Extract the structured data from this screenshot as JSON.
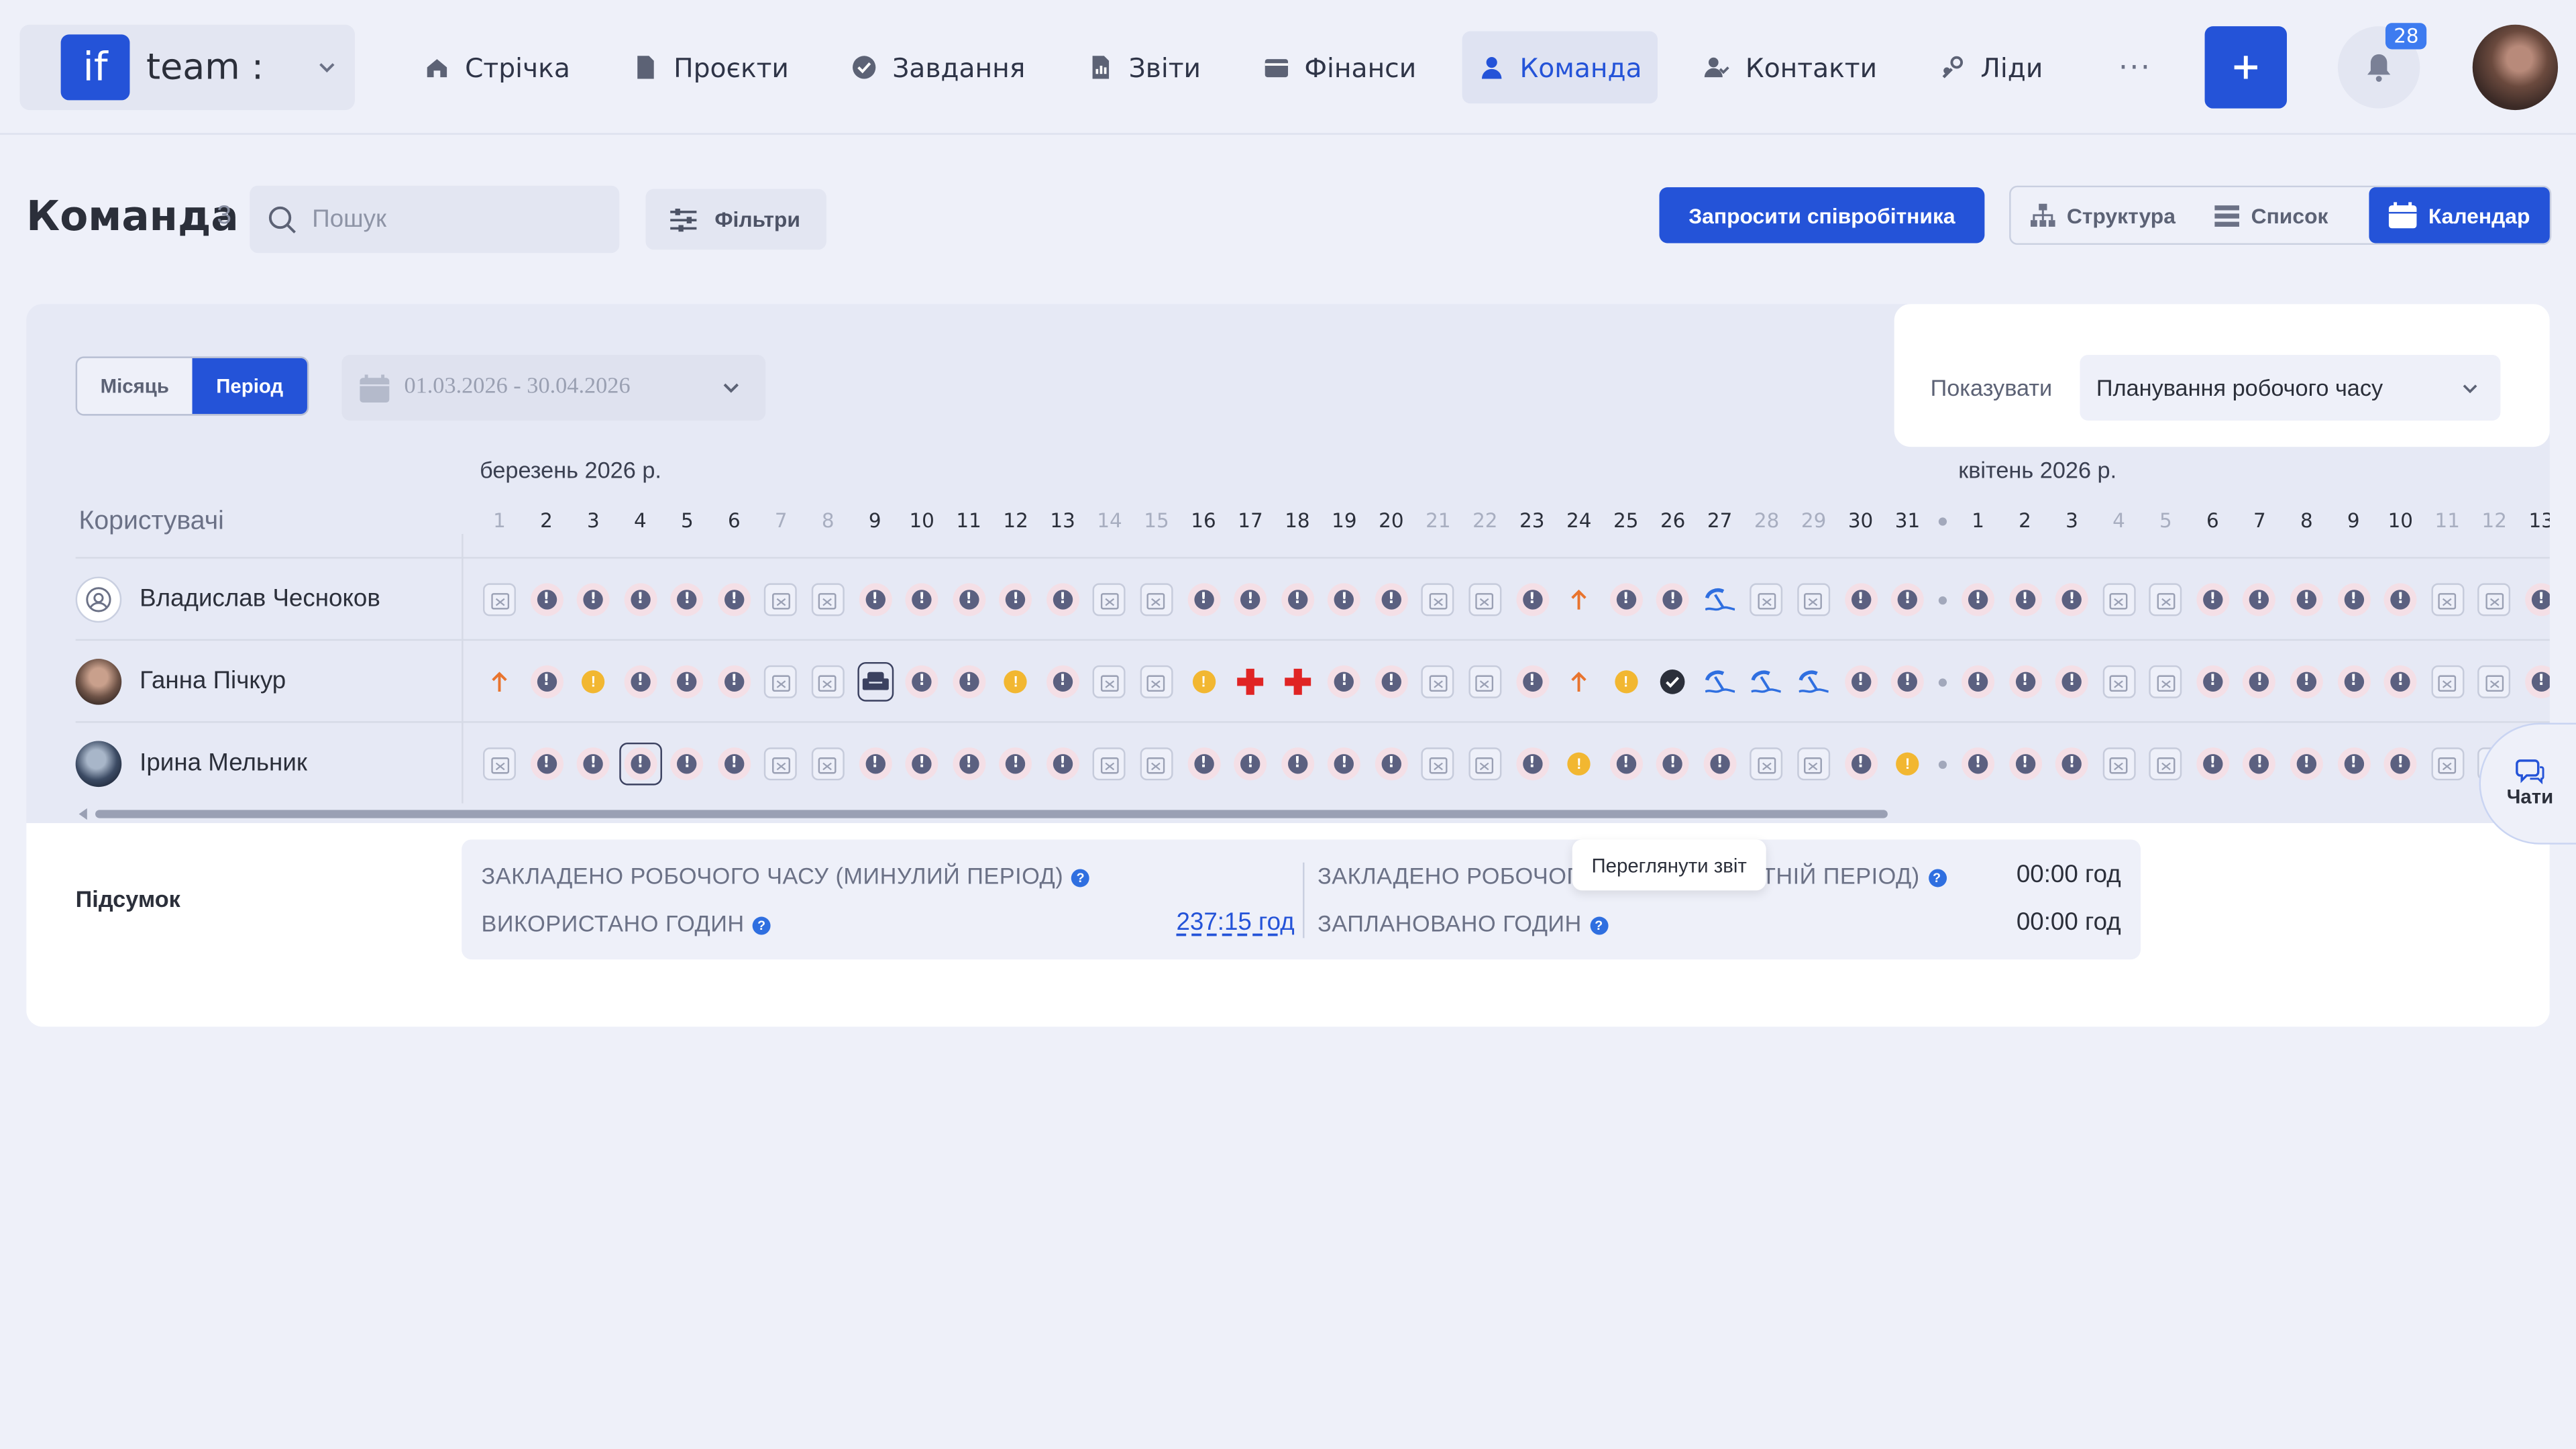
{
  "app": {
    "workspace": "team :",
    "logo": "if",
    "notifications": "28"
  },
  "nav": [
    {
      "label": "Стрічка",
      "icon": "home-icon"
    },
    {
      "label": "Проєкти",
      "icon": "file-icon"
    },
    {
      "label": "Завдання",
      "icon": "check-circle-icon"
    },
    {
      "label": "Звіти",
      "icon": "chart-icon"
    },
    {
      "label": "Фінанси",
      "icon": "wallet-icon"
    },
    {
      "label": "Команда",
      "icon": "user-icon",
      "active": true
    },
    {
      "label": "Контакти",
      "icon": "contacts-icon"
    },
    {
      "label": "Ліди",
      "icon": "leads-icon"
    }
  ],
  "nav_more": "···",
  "page": {
    "title": "Команда",
    "count": "3",
    "search_placeholder": "Пошук",
    "filters": "Фільтри",
    "invite": "Запросити співробітника",
    "views": [
      "Структура",
      "Список",
      "Календар"
    ],
    "active_view": "Календар"
  },
  "calendar": {
    "mode_month": "Місяць",
    "mode_period": "Період",
    "active_mode": "Період",
    "date_range": "01.03.2026 - 30.04.2026",
    "show_label": "Показувати",
    "show_value": "Планування робочого часу",
    "users_label": "Користувачі",
    "month1": "березень 2026 р.",
    "month2": "квітень 2026 р.",
    "march_days": [
      "1",
      "2",
      "3",
      "4",
      "5",
      "6",
      "7",
      "8",
      "9",
      "10",
      "11",
      "12",
      "13",
      "14",
      "15",
      "16",
      "17",
      "18",
      "19",
      "20",
      "21",
      "22",
      "23",
      "24",
      "25",
      "26",
      "27",
      "28",
      "29",
      "30",
      "31"
    ],
    "april_days": [
      "1",
      "2",
      "3",
      "4",
      "5",
      "6",
      "7",
      "8",
      "9",
      "10",
      "11",
      "12",
      "13"
    ],
    "weekend_march": [
      "1",
      "7",
      "8",
      "14",
      "15",
      "21",
      "22",
      "28",
      "29"
    ],
    "weekend_april": [
      "4",
      "5",
      "11",
      "12"
    ],
    "legend": {
      "E": "unfilled",
      "W": "weekend",
      "Y": "pending",
      "U": "arrow-up-icon",
      "S": "sick-icon",
      "V": "vacation-icon",
      "K": "approved-icon",
      "C": "couch-icon",
      "D": "month-divider"
    },
    "users": [
      {
        "name": "Владислав Чесноков",
        "row": "WEEEEEWWEEEEEWWEEEEEWWEUEEVWWEE|EEEWWEEEEEWWE"
      },
      {
        "name": "Ганна Пічкур",
        "row": "UEYEEEWWCEEYEWWYSSEEWWEUYKVVVEE|EEEWWEEEEEWWE"
      },
      {
        "name": "Ірина Мельник",
        "row": "WEEEEEWWEEEEEWWEEEEEWWEYEEEWWEY|EEEWWEEEEEWWE"
      }
    ]
  },
  "summary": {
    "label": "Підсумок",
    "past_planned": "ЗАКЛАДЕНО РОБОЧОГО ЧАСУ (МИНУЛИЙ ПЕРІОД)",
    "used": "ВИКОРИСТАНО ГОДИН",
    "used_value": "237:15 год",
    "tooltip": "Переглянути звіт",
    "future_planned": "ЗАКЛАДЕНО РОБОЧОГО ЧАСУ (МАЙБУТНІЙ ПЕРІОД)",
    "future_value": "00:00 год",
    "scheduled": "ЗАПЛАНОВАНО ГОДИН",
    "scheduled_value": "00:00 год"
  },
  "chats": "Чати",
  "colors": {
    "accent": "#2453d8",
    "bg": "#eef0f9",
    "card": "#e6e9f5"
  }
}
